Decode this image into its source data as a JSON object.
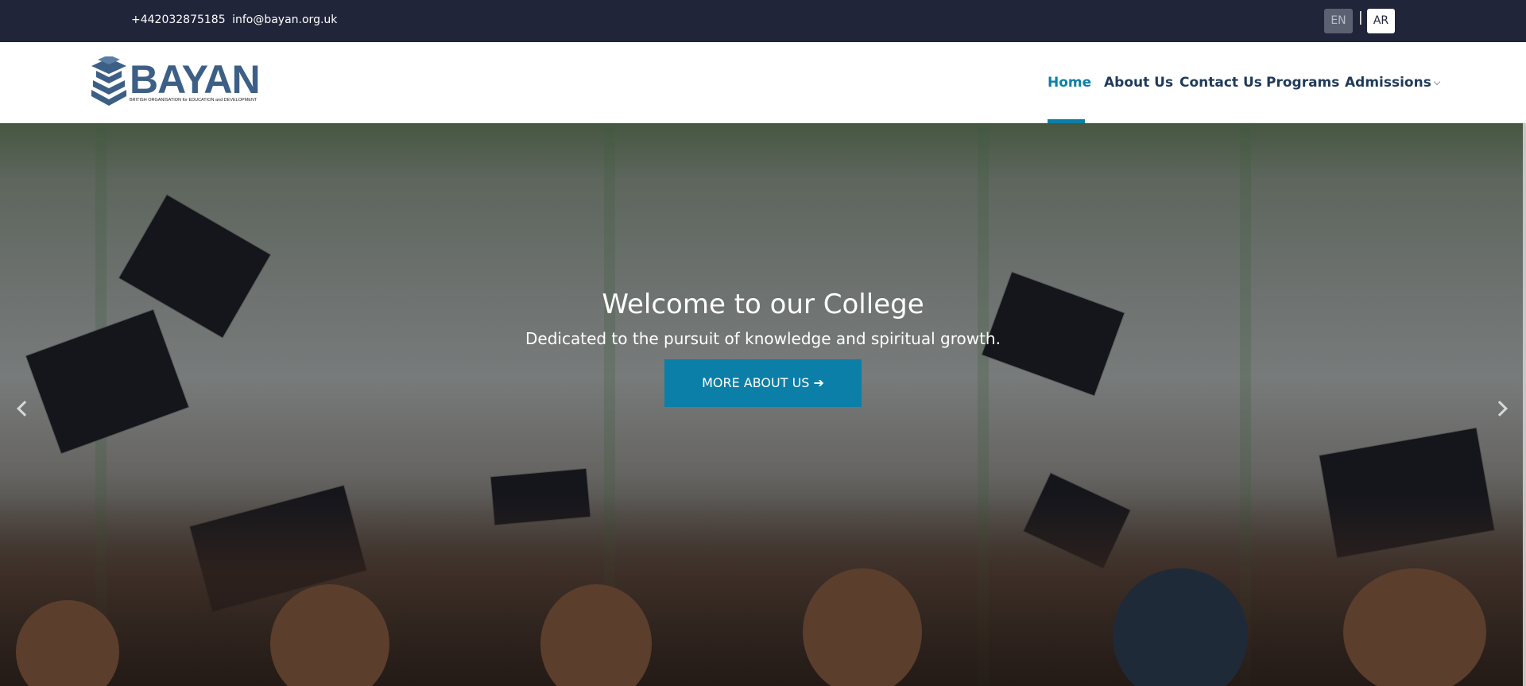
{
  "topbar": {
    "phone": "+442032875185",
    "email": "info@bayan.org.uk",
    "lang_en": "EN",
    "lang_sep": "|",
    "lang_ar": "AR"
  },
  "header": {
    "logo_text": "BAYAN",
    "logo_subtitle": "BRITISH ORGANISATION for EDUCATION and DEVELOPMENT",
    "nav": [
      {
        "label": "Home",
        "active": true
      },
      {
        "label": "About Us"
      },
      {
        "label": "Contact Us"
      },
      {
        "label": "Programs"
      },
      {
        "label": "Admissions",
        "has_dropdown": true
      }
    ]
  },
  "hero": {
    "title": "Welcome to our College",
    "subtitle": "Dedicated to the pursuit of knowledge and spiritual growth.",
    "button_label": "MORE ABOUT US ➔"
  },
  "colors": {
    "topbar_bg": "#21253a",
    "accent": "#0b7fa8",
    "nav_text": "#1f3a5a",
    "logo": "#3c5f86"
  },
  "icons": [
    "mortarboard-logo-icon",
    "chevron-down-icon",
    "arrow-right-icon",
    "carousel-prev-icon",
    "carousel-next-icon"
  ]
}
